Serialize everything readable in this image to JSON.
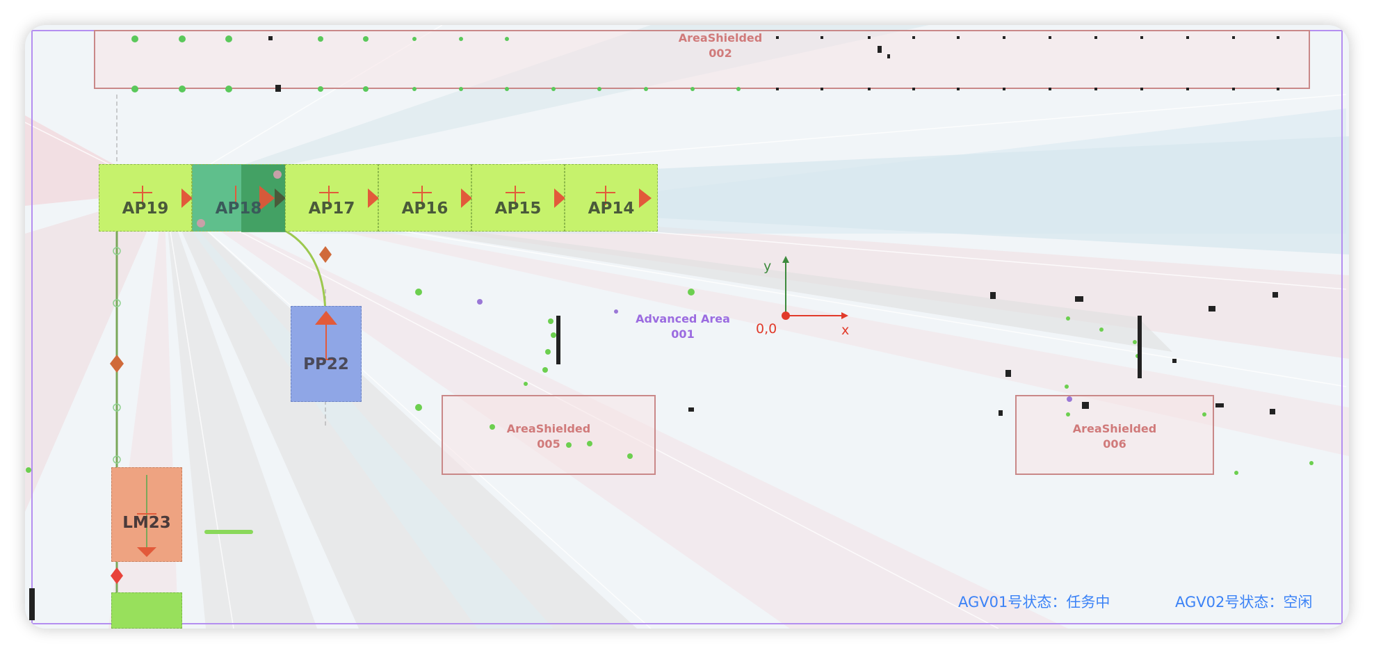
{
  "map": {
    "title": "",
    "load_points": [
      {
        "id": "ap19",
        "label": "AP19"
      },
      {
        "id": "ap18",
        "label": "AP18"
      },
      {
        "id": "ap17",
        "label": "AP17"
      },
      {
        "id": "ap16",
        "label": "AP16"
      },
      {
        "id": "ap15",
        "label": "AP15"
      },
      {
        "id": "ap14",
        "label": "AP14"
      }
    ],
    "pick_point": {
      "label": "PP22"
    },
    "lm_point": {
      "label": "LM23"
    },
    "areas": {
      "shielded_002": {
        "name": "AreaShielded",
        "id": "002"
      },
      "shielded_005": {
        "name": "AreaShielded",
        "id": "005"
      },
      "shielded_006": {
        "name": "AreaShielded",
        "id": "006"
      },
      "advanced_001": {
        "name": "Advanced Area",
        "id": "001"
      }
    },
    "origin": {
      "label": "0,0",
      "x_axis": "x",
      "y_axis": "y"
    }
  },
  "status": {
    "agv01": "AGV01号状态：任务中",
    "agv02": "AGV02号状态：空闲"
  },
  "colors": {
    "load_point": "#c6f26c",
    "selected_point": "#3c9a5a",
    "pick_point": "#8fa6e6",
    "lm_point": "#eea381",
    "shield_area_border": "#c98888",
    "advanced_area_text": "#9b6be0",
    "status_text": "#3b82f6",
    "axis_red": "#e13a2a",
    "axis_green": "#3d8a3d"
  }
}
